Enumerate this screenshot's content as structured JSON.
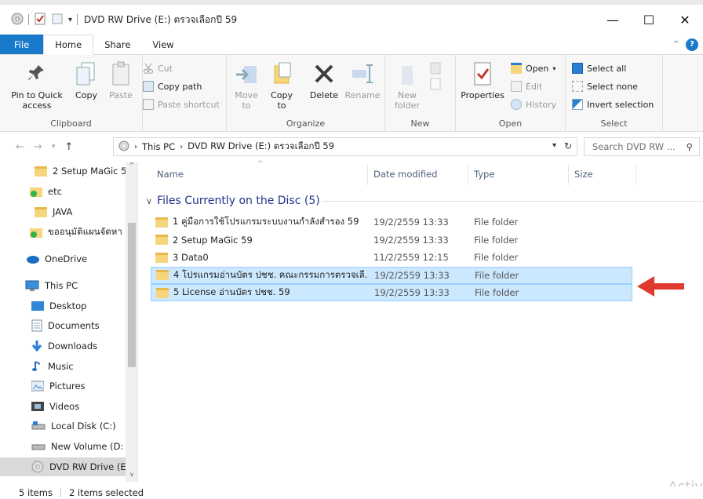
{
  "window": {
    "title": "DVD RW Drive (E:) ตรวจเลือกปี 59",
    "controls": [
      "—",
      "☐",
      "✕"
    ]
  },
  "tabs": [
    "File",
    "Home",
    "Share",
    "View"
  ],
  "ribbon": {
    "clipboard": {
      "label": "Clipboard",
      "pin": "Pin to Quick access",
      "copy": "Copy",
      "paste": "Paste",
      "cut": "Cut",
      "copy_path": "Copy path",
      "paste_shortcut": "Paste shortcut"
    },
    "organize": {
      "label": "Organize",
      "move_to": "Move to",
      "copy_to": "Copy to",
      "delete": "Delete",
      "rename": "Rename"
    },
    "new": {
      "label": "New",
      "new_folder": "New folder"
    },
    "open": {
      "label": "Open",
      "properties": "Properties",
      "open": "Open",
      "edit": "Edit",
      "history": "History"
    },
    "select": {
      "label": "Select",
      "select_all": "Select all",
      "select_none": "Select none",
      "invert": "Invert selection"
    }
  },
  "address": {
    "path": [
      "This PC",
      "DVD RW Drive (E:) ตรวจเลือกปี 59"
    ],
    "search_placeholder": "Search DVD RW ..."
  },
  "nav": [
    {
      "label": "2 Setup MaGic 5",
      "icon": "folder-icon",
      "selected": false
    },
    {
      "label": "etc",
      "icon": "folder-sync-icon",
      "selected": false
    },
    {
      "label": "JAVA",
      "icon": "folder-icon",
      "selected": false
    },
    {
      "label": "ขออนุมัติแผนจัดหา",
      "icon": "folder-sync-icon",
      "selected": false
    },
    {
      "label": "OneDrive",
      "icon": "onedrive-icon",
      "selected": false
    },
    {
      "label": "This PC",
      "icon": "pc-icon",
      "selected": false
    },
    {
      "label": "Desktop",
      "icon": "desktop-icon",
      "selected": false
    },
    {
      "label": "Documents",
      "icon": "documents-icon",
      "selected": false
    },
    {
      "label": "Downloads",
      "icon": "downloads-icon",
      "selected": false
    },
    {
      "label": "Music",
      "icon": "music-icon",
      "selected": false
    },
    {
      "label": "Pictures",
      "icon": "pictures-icon",
      "selected": false
    },
    {
      "label": "Videos",
      "icon": "videos-icon",
      "selected": false
    },
    {
      "label": "Local Disk (C:)",
      "icon": "local-disk-icon",
      "selected": false
    },
    {
      "label": "New Volume (D:",
      "icon": "volume-icon",
      "selected": false
    },
    {
      "label": "DVD RW Drive (E",
      "icon": "dvd-icon",
      "selected": true
    }
  ],
  "columns": [
    "Name",
    "Date modified",
    "Type",
    "Size"
  ],
  "group": {
    "title": "Files Currently on the Disc (5)"
  },
  "files": [
    {
      "name": "1 คู่มือการใช้โปรแกรมระบบงานกำลังสำรอง 59",
      "date": "19/2/2559 13:33",
      "type": "File folder",
      "selected": false
    },
    {
      "name": "2 Setup MaGic 59",
      "date": "19/2/2559 13:33",
      "type": "File folder",
      "selected": false
    },
    {
      "name": "3 Data0",
      "date": "11/2/2559 12:15",
      "type": "File folder",
      "selected": false
    },
    {
      "name": "4 โปรแกรมอ่านบัตร ปชช. คณะกรรมการตรวจเลื...",
      "date": "19/2/2559 13:33",
      "type": "File folder",
      "selected": true
    },
    {
      "name": "5 License อ่านบัตร ปชช. 59",
      "date": "19/2/2559 13:33",
      "type": "File folder",
      "selected": true
    }
  ],
  "status": {
    "count": "5 items",
    "selected": "2 items selected"
  },
  "watermark": "Activ",
  "colors": {
    "accent": "#1979ca",
    "selection": "#cce8ff",
    "arrow": "#e03a2f"
  }
}
